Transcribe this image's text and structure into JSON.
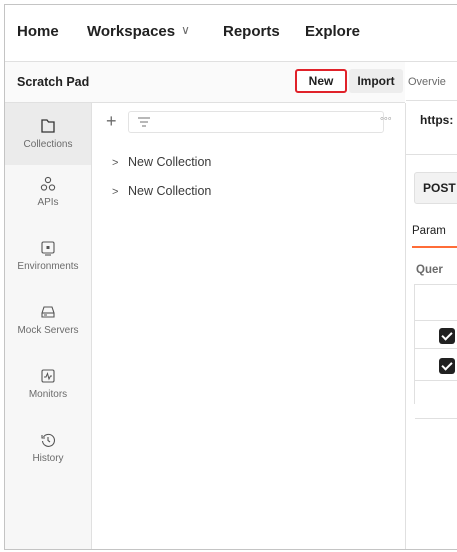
{
  "nav": {
    "home": "Home",
    "workspaces": "Workspaces",
    "workspaces_chevron": "∨",
    "reports": "Reports",
    "explore": "Explore"
  },
  "header": {
    "title": "Scratch Pad",
    "new_label": "New",
    "import_label": "Import"
  },
  "sidebar": {
    "items": [
      {
        "label": "Collections",
        "icon": "collections-icon"
      },
      {
        "label": "APIs",
        "icon": "apis-icon"
      },
      {
        "label": "Environments",
        "icon": "environments-icon"
      },
      {
        "label": "Mock Servers",
        "icon": "mock-servers-icon"
      },
      {
        "label": "Monitors",
        "icon": "monitors-icon"
      },
      {
        "label": "History",
        "icon": "history-icon"
      }
    ]
  },
  "collections": {
    "more_label": "◦◦◦",
    "items": [
      {
        "label": "New Collection"
      },
      {
        "label": "New Collection"
      }
    ]
  },
  "right": {
    "tab": "Overvie",
    "url": "https:",
    "method": "POST",
    "params_tab": "Param",
    "query_label": "Quer"
  },
  "colors": {
    "highlight": "#e0222a",
    "accent": "#ff6c37"
  }
}
